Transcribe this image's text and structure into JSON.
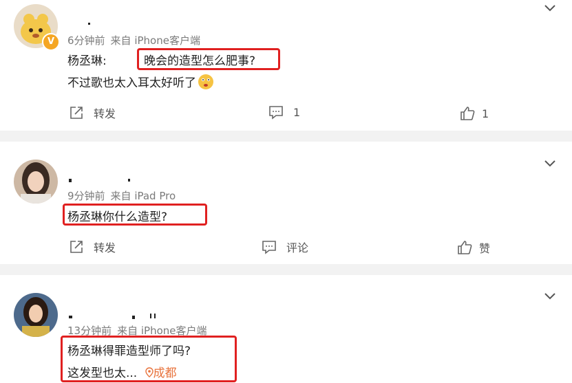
{
  "comments": [
    {
      "time": "6分钟前",
      "source": "来自 iPhone客户端",
      "name_fragment": "杨丞琳:",
      "highlighted_text": "晚会的造型怎么肥事?",
      "second_line": "不过歌也太入耳太好听了",
      "actions": {
        "repost": "转发",
        "comment_count": "1",
        "like_count": "1"
      },
      "badge": "V"
    },
    {
      "time": "9分钟前",
      "source": "来自 iPad Pro",
      "highlighted_text": "杨丞琳你什么造型?",
      "actions": {
        "repost": "转发",
        "comment": "评论",
        "like": "赞"
      }
    },
    {
      "time": "13分钟前",
      "source": "来自 iPhone客户端",
      "highlighted_line1": "杨丞琳得罪造型师了吗?",
      "highlighted_line2": "这发型也太...",
      "location": "成都"
    }
  ],
  "colors": {
    "highlight": "#e02020",
    "location": "#e8733c",
    "separator": "#f2f2f2",
    "badge": "#f5a623"
  },
  "icons": [
    "chevron-down-icon",
    "share-icon",
    "comment-icon",
    "like-icon",
    "location-pin-icon",
    "emoji-icon",
    "verified-badge-icon"
  ]
}
